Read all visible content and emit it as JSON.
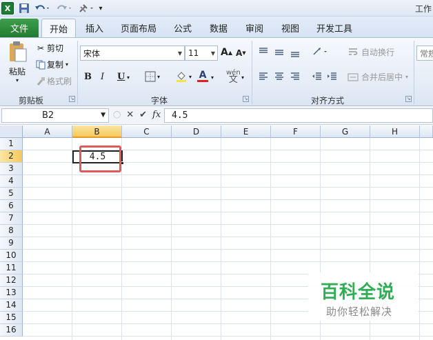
{
  "window": {
    "title": "工作"
  },
  "ribbon_tabs": [
    "文件",
    "开始",
    "插入",
    "页面布局",
    "公式",
    "数据",
    "审阅",
    "视图",
    "开发工具"
  ],
  "active_tab": "开始",
  "clipboard": {
    "paste": "粘贴",
    "cut": "剪切",
    "copy": "复制",
    "format_painter": "格式刷",
    "label": "剪贴板"
  },
  "font": {
    "name": "宋体",
    "size": "11",
    "bold": "B",
    "italic": "I",
    "underline": "U",
    "grow": "A",
    "shrink": "A",
    "font_color": "A",
    "phonetic": "wén",
    "label": "字体"
  },
  "alignment": {
    "wrap_text": "自动换行",
    "merge_center": "合并后居中",
    "label": "对齐方式"
  },
  "number": {
    "format": "常规"
  },
  "formula_bar": {
    "name_box": "B2",
    "fx": "fx",
    "value": "4.5"
  },
  "grid": {
    "columns": [
      "A",
      "B",
      "C",
      "D",
      "E",
      "F",
      "G",
      "H"
    ],
    "rows": [
      "1",
      "2",
      "3",
      "4",
      "5",
      "6",
      "7",
      "8",
      "9",
      "10",
      "11",
      "12",
      "13",
      "14",
      "15",
      "16"
    ],
    "selected_cell": {
      "col": "B",
      "row": "2",
      "value": "4.5"
    }
  },
  "watermark": {
    "title": "百科全说",
    "subtitle": "助你轻松解决"
  },
  "colors": {
    "file_tab": "#1f7b30",
    "highlight_box": "#e05a5a",
    "selected_header": "#f6c95c",
    "watermark": "#2fae55"
  }
}
